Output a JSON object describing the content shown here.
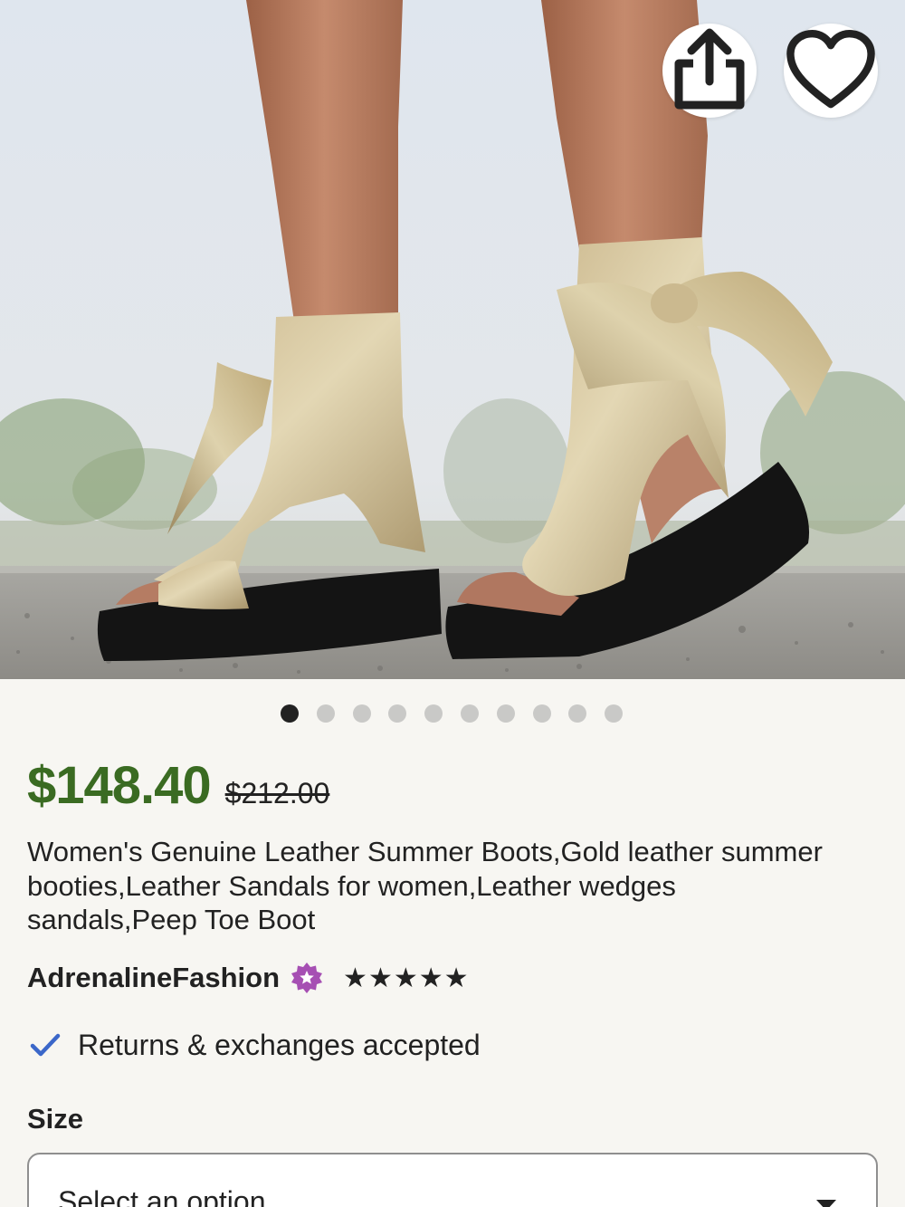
{
  "hero": {
    "photo": "gold-leather-sandal-boots-photo",
    "image_count": 10,
    "active_index": 0,
    "share_icon": "share-icon",
    "favorite_icon": "heart-icon"
  },
  "product": {
    "price": "$148.40",
    "original_price": "$212.00",
    "title": "Women's Genuine Leather Summer Boots,Gold leather summer booties,Leather Sandals for women,Leather wedges sandals,Peep Toe Boot",
    "price_color": "#3a6b22"
  },
  "shop": {
    "name": "AdrenalineFashion",
    "badge_icon": "star-seller-badge-icon",
    "rating": 5,
    "stars": "★★★★★",
    "badge_color": "#a64fb3"
  },
  "policies": {
    "returns": "Returns & exchanges accepted",
    "check_color": "#3b67c9"
  },
  "variation": {
    "label": "Size",
    "placeholder": "Select an option"
  }
}
